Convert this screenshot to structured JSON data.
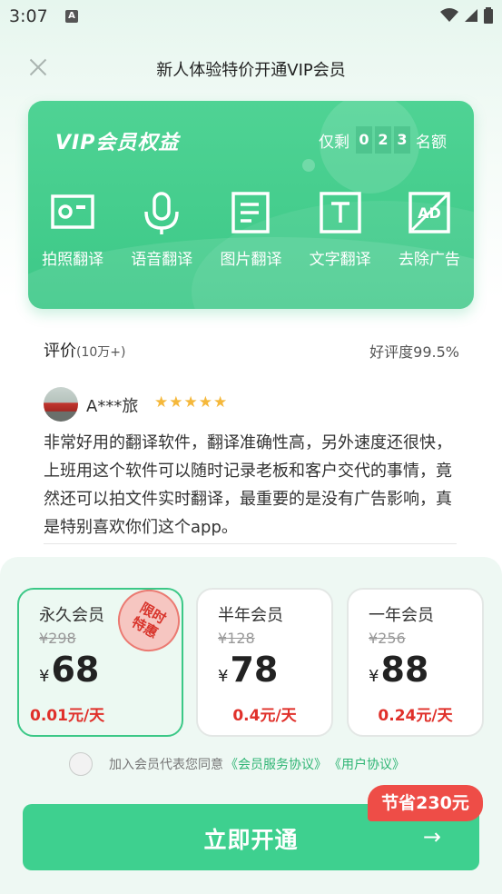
{
  "status_bar": {
    "time": "3:07",
    "notification_letter": "A"
  },
  "header": {
    "title": "新人体验特价开通VIP会员"
  },
  "vip_card": {
    "title": "VIP会员权益",
    "remaining_prefix": "仅剩",
    "remaining_digits": [
      "0",
      "2",
      "3"
    ],
    "remaining_suffix": "名额",
    "features": [
      {
        "label": "拍照翻译",
        "icon": "camera-icon"
      },
      {
        "label": "语音翻译",
        "icon": "microphone-icon"
      },
      {
        "label": "图片翻译",
        "icon": "document-icon"
      },
      {
        "label": "文字翻译",
        "icon": "text-icon"
      },
      {
        "label": "去除广告",
        "icon": "no-ads-icon"
      }
    ]
  },
  "reviews": {
    "heading": "评价",
    "count": "(10万+)",
    "rating": "好评度99.5%",
    "item": {
      "name": "A***旅",
      "stars": 5,
      "text": "非常好用的翻译软件，翻译准确性高，另外速度还很快，上班用这个软件可以随时记录老板和客户交代的事情，竟然还可以拍文件实时翻译，最重要的是没有广告影响，真是特别喜欢你们这个app。"
    }
  },
  "plans": [
    {
      "name": "永久会员",
      "original": "¥298",
      "currency": "¥",
      "price": "68",
      "per_day": "0.01元/天",
      "badge": "限时\n特惠",
      "selected": true
    },
    {
      "name": "半年会员",
      "original": "¥128",
      "currency": "¥",
      "price": "78",
      "per_day": "0.4元/天",
      "selected": false
    },
    {
      "name": "一年会员",
      "original": "¥256",
      "currency": "¥",
      "price": "88",
      "per_day": "0.24元/天",
      "selected": false
    }
  ],
  "agreement": {
    "text": "加入会员代表您同意",
    "link1": "《会员服务协议》",
    "link2": "《用户协议》"
  },
  "cta": {
    "label": "立即开通",
    "arrow": "→",
    "save_tag": "节省230元"
  },
  "colors": {
    "accent": "#3cc887",
    "price_red": "#e0302a",
    "tag_red": "#ee4d47"
  }
}
